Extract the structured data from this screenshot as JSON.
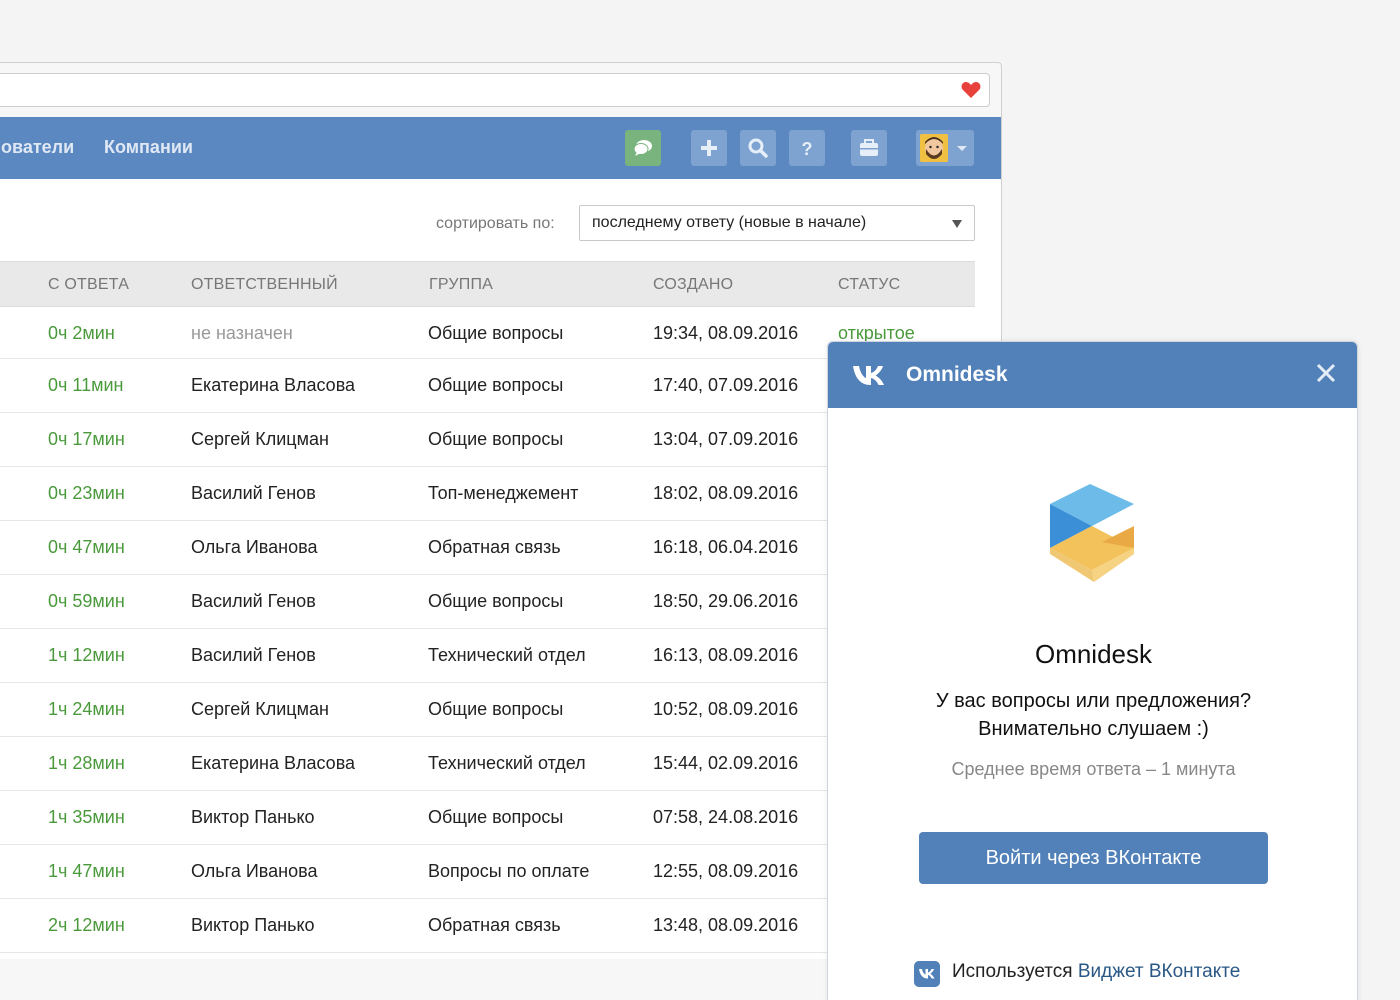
{
  "nav": {
    "link_users": "ователи",
    "link_companies": "Компании"
  },
  "sort": {
    "label": "сортировать по:",
    "value": "последнему ответу (новые в начале)"
  },
  "table": {
    "headers": [
      "С ОТВЕТА",
      "ОТВЕТСТВЕННЫЙ",
      "ГРУППА",
      "СОЗДАНО",
      "СТАТУС"
    ],
    "rows": [
      {
        "since": "0ч 2мин",
        "assignee": "не назначен",
        "group": "Общие вопросы",
        "created": "19:34, 08.09.2016",
        "status": "открытое"
      },
      {
        "since": "0ч 11мин",
        "assignee": "Екатерина Власова",
        "group": "Общие вопросы",
        "created": "17:40, 07.09.2016",
        "status": ""
      },
      {
        "since": "0ч 17мин",
        "assignee": "Сергей Клицман",
        "group": "Общие вопросы",
        "created": "13:04, 07.09.2016",
        "status": ""
      },
      {
        "since": "0ч 23мин",
        "assignee": "Василий Генов",
        "group": "Топ-менеджемент",
        "created": "18:02, 08.09.2016",
        "status": ""
      },
      {
        "since": "0ч 47мин",
        "assignee": "Ольга Иванова",
        "group": "Обратная связь",
        "created": "16:18, 06.04.2016",
        "status": ""
      },
      {
        "since": "0ч 59мин",
        "assignee": "Василий Генов",
        "group": "Общие вопросы",
        "created": "18:50, 29.06.2016",
        "status": ""
      },
      {
        "since": "1ч 12мин",
        "assignee": "Василий Генов",
        "group": "Технический отдел",
        "created": "16:13, 08.09.2016",
        "status": ""
      },
      {
        "since": "1ч 24мин",
        "assignee": "Сергей Клицман",
        "group": "Общие вопросы",
        "created": "10:52, 08.09.2016",
        "status": ""
      },
      {
        "since": "1ч 28мин",
        "assignee": "Екатерина Власова",
        "group": "Технический отдел",
        "created": "15:44, 02.09.2016",
        "status": ""
      },
      {
        "since": "1ч 35мин",
        "assignee": "Виктор Панько",
        "group": "Общие вопросы",
        "created": "07:58, 24.08.2016",
        "status": ""
      },
      {
        "since": "1ч 47мин",
        "assignee": "Ольга Иванова",
        "group": "Вопросы по оплате",
        "created": "12:55, 08.09.2016",
        "status": ""
      },
      {
        "since": "2ч 12мин",
        "assignee": "Виктор Панько",
        "group": "Обратная связь",
        "created": "13:48, 08.09.2016",
        "status": ""
      }
    ]
  },
  "widget": {
    "title": "Omnidesk",
    "name": "Omnidesk",
    "message_line1": "У вас вопросы или предложения?",
    "message_line2": "Внимательно слушаем :)",
    "response_time": "Среднее время ответа – 1 минута",
    "login_button": "Войти через ВКонтакте",
    "footer_text": "Используется",
    "footer_link": "Виджет ВКонтакте"
  },
  "colors": {
    "navbar": "#5b88c1",
    "vk_blue": "#5181b8",
    "green_text": "#4a9a3c",
    "chat_button": "#79b37d"
  }
}
